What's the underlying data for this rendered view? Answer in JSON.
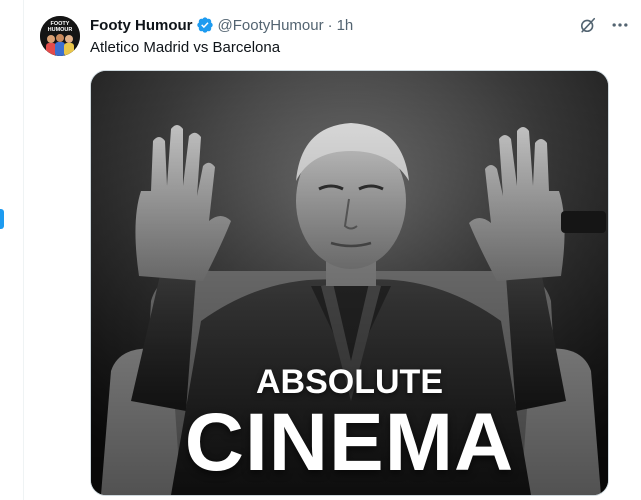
{
  "tweet": {
    "author_name": "Footy Humour",
    "handle": "@FootyHumour",
    "separator": "·",
    "time": "1h",
    "text": "Atletico Madrid vs Barcelona",
    "avatar_label_line1": "FOOTY",
    "avatar_label_line2": "HUMOUR"
  },
  "media": {
    "caption_line1": "ABSOLUTE",
    "caption_line2": "CINEMA"
  },
  "icons": {
    "verified": "verified-badge-icon",
    "grok": "grok-icon",
    "more": "more-options-icon"
  },
  "colors": {
    "accent": "#1d9bf0",
    "text": "#0f1419",
    "muted": "#536471"
  }
}
